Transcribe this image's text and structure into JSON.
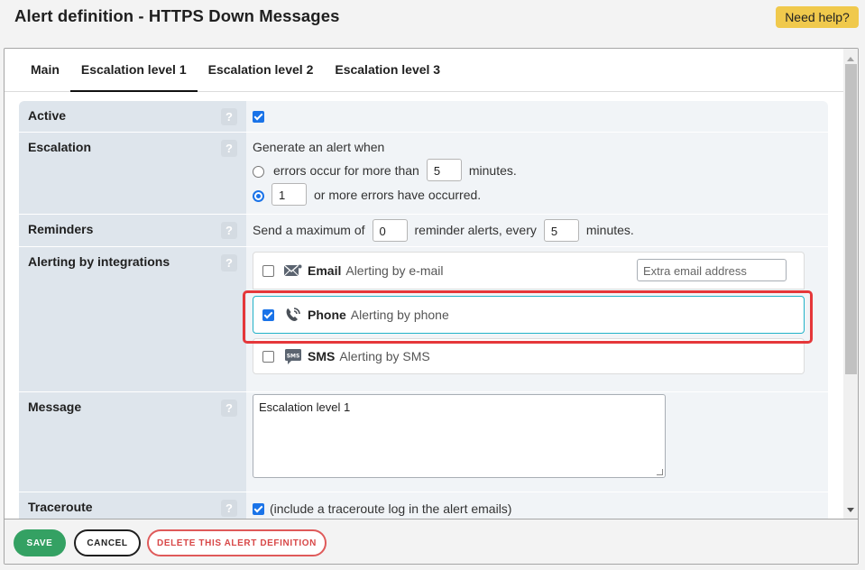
{
  "header": {
    "title": "Alert definition - HTTPS Down Messages",
    "help_label": "Need help?"
  },
  "tabs": [
    {
      "label": "Main",
      "active": false
    },
    {
      "label": "Escalation level 1",
      "active": true
    },
    {
      "label": "Escalation level 2",
      "active": false
    },
    {
      "label": "Escalation level 3",
      "active": false
    }
  ],
  "form": {
    "help_glyph": "?",
    "active": {
      "label": "Active",
      "checked": true
    },
    "escalation": {
      "label": "Escalation",
      "intro": "Generate an alert when",
      "option1_text": "errors occur for more than",
      "option1_value": "5",
      "option1_suffix": "minutes.",
      "option1_selected": false,
      "option2_value": "1",
      "option2_text": "or more errors have occurred.",
      "option2_selected": true
    },
    "reminders": {
      "label": "Reminders",
      "prefix": "Send a maximum of",
      "max_value": "0",
      "middle": "reminder alerts, every",
      "interval_value": "5",
      "suffix": "minutes."
    },
    "integrations": {
      "label": "Alerting by integrations",
      "items": [
        {
          "icon": "email-icon",
          "name": "Email",
          "description": "Alerting by e-mail",
          "checked": false,
          "extra_placeholder": "Extra email address"
        },
        {
          "icon": "phone-icon",
          "name": "Phone",
          "description": "Alerting by phone",
          "checked": true
        },
        {
          "icon": "sms-icon",
          "name": "SMS",
          "description": "Alerting by SMS",
          "checked": false
        }
      ]
    },
    "message": {
      "label": "Message",
      "value": "Escalation level 1"
    },
    "traceroute": {
      "label": "Traceroute",
      "checked": true,
      "text": "(include a traceroute log in the alert emails)"
    }
  },
  "footer": {
    "save_label": "SAVE",
    "cancel_label": "CANCEL",
    "delete_label": "DELETE THIS ALERT DEFINITION"
  },
  "colors": {
    "save": "#34a163",
    "delete": "#df5a5a",
    "help": "#f0c94c",
    "highlight": "#e5373a",
    "selected_integration": "#22b2c8",
    "checkbox": "#1a73e8"
  }
}
